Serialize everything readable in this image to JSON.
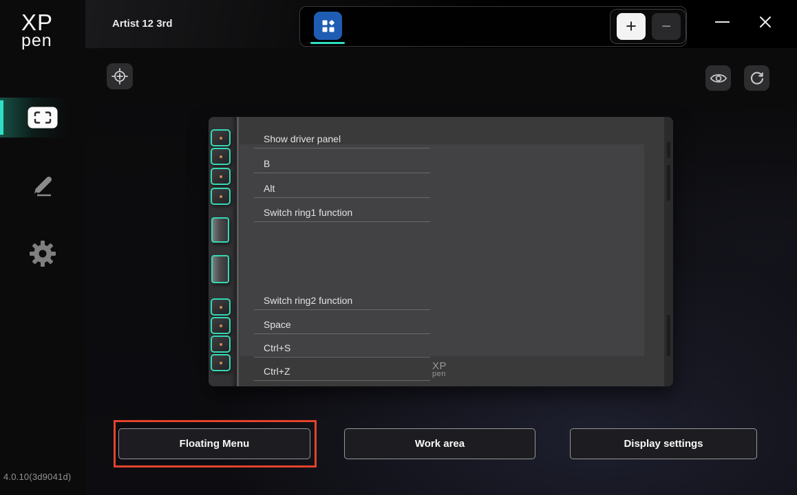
{
  "window": {
    "title": "Artist 12 3rd",
    "version": "4.0.10(3d9041d)"
  },
  "brand": {
    "logo_top": "XP",
    "logo_bottom": "pen"
  },
  "sidebar": {
    "items": [
      {
        "id": "work-area",
        "icon": "work-area-icon",
        "active": true
      },
      {
        "id": "pen-settings",
        "icon": "pen-icon",
        "active": false
      },
      {
        "id": "app-settings",
        "icon": "gear-icon",
        "active": false
      }
    ]
  },
  "tabbar": {
    "active_tab_icon": "device-grid-icon",
    "add_label": "+",
    "remove_label": "−"
  },
  "toolbar": {
    "icons": [
      "crosshair-locate-icon",
      "eye-preview-icon",
      "refresh-icon"
    ]
  },
  "shortcuts": {
    "rows": [
      "Show driver panel",
      "B",
      "Alt",
      "Switch ring1 function",
      "Switch ring2 function",
      "Space",
      "Ctrl+S",
      "Ctrl+Z"
    ]
  },
  "device": {
    "logo_top": "XP",
    "logo_bottom": "pen"
  },
  "footer": {
    "buttons": [
      {
        "label": "Floating Menu",
        "highlighted": true
      },
      {
        "label": "Work area",
        "highlighted": false
      },
      {
        "label": "Display settings",
        "highlighted": false
      }
    ]
  },
  "colors": {
    "accent": "#2fe0c4",
    "highlight_box": "#e3432b",
    "tab_blue": "#1f5db4",
    "key_dot": "#cf8a4f"
  }
}
